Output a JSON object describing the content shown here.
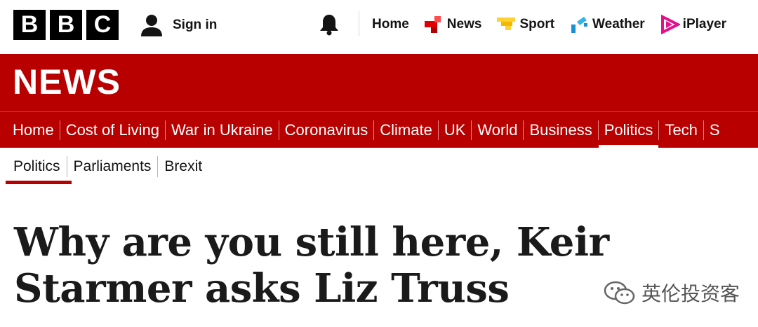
{
  "brand": {
    "letters": [
      "B",
      "B",
      "C"
    ]
  },
  "account": {
    "sign_in_label": "Sign in"
  },
  "topnav": {
    "items": [
      {
        "label": "Home",
        "icon": "none"
      },
      {
        "label": "News",
        "icon": "news-icon",
        "color": "#e00000"
      },
      {
        "label": "Sport",
        "icon": "sport-icon",
        "color": "#ffd230"
      },
      {
        "label": "Weather",
        "icon": "weather-icon",
        "color": "#1a91d6"
      },
      {
        "label": "iPlayer",
        "icon": "iplayer-icon",
        "color": "#e4108c"
      }
    ]
  },
  "header": {
    "title": "NEWS",
    "background": "#b80000"
  },
  "section_nav": {
    "items": [
      "Home",
      "Cost of Living",
      "War in Ukraine",
      "Coronavirus",
      "Climate",
      "UK",
      "World",
      "Business",
      "Politics",
      "Tech",
      "S"
    ],
    "active": "Politics"
  },
  "sub_nav": {
    "items": [
      "Politics",
      "Parliaments",
      "Brexit"
    ],
    "active": "Politics"
  },
  "article": {
    "headline": "Why are you still here, Keir Starmer asks Liz Truss"
  },
  "watermark": {
    "text": "英伦投资客",
    "icon": "wechat-icon"
  }
}
